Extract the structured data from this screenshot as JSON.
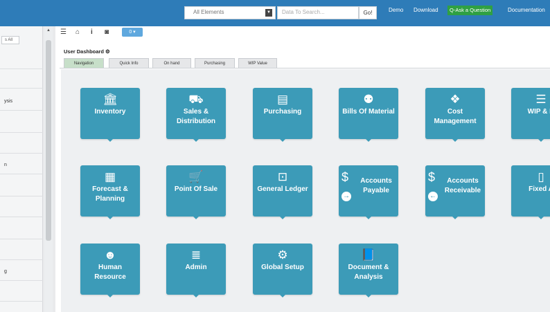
{
  "topbar": {
    "search_scope": "All Elements",
    "search_placeholder": "Data To Search...",
    "go_label": "Go!",
    "links": {
      "demo": "Demo",
      "download": "Download",
      "ask": "Q-Ask a Question",
      "documentation": "Documentation"
    }
  },
  "sidebar": {
    "expand_label": "s All",
    "rows": [
      "ysis",
      "n",
      "g"
    ]
  },
  "toolbar": {
    "badge": "0 ▾"
  },
  "dashboard": {
    "title": "User Dashboard",
    "tabs": [
      "Navigation",
      "Quick Info",
      "On hand",
      "Purchasing",
      "WIP Value"
    ],
    "active_tab": "Navigation"
  },
  "tiles": [
    {
      "label": "Inventory",
      "icon": "bank-icon"
    },
    {
      "label": "Sales & Distribution",
      "icon": "truck-icon"
    },
    {
      "label": "Purchasing",
      "icon": "document-icon"
    },
    {
      "label": "Bills Of Material",
      "icon": "sitemap-icon"
    },
    {
      "label": "Cost Management",
      "icon": "cubes-icon"
    },
    {
      "label": "WIP & N",
      "icon": "server-icon"
    },
    {
      "label": "Forecast & Planning",
      "icon": "grid-icon"
    },
    {
      "label": "Point Of Sale",
      "icon": "cart-icon"
    },
    {
      "label": "General Ledger",
      "icon": "money-icon"
    },
    {
      "label": "Accounts Payable",
      "icon": "dollar-out-icon"
    },
    {
      "label": "Accounts Receivable",
      "icon": "dollar-in-icon"
    },
    {
      "label": "Fixed A",
      "icon": "calculator-icon"
    },
    {
      "label": "Human Resource",
      "icon": "users-icon"
    },
    {
      "label": "Admin",
      "icon": "database-icon"
    },
    {
      "label": "Global Setup",
      "icon": "gears-icon"
    },
    {
      "label": "Document & Analysis",
      "icon": "book-icon"
    }
  ],
  "colors": {
    "topbar": "#2e7cb8",
    "tile": "#3c9bb8",
    "ask_button": "#2fa043"
  }
}
